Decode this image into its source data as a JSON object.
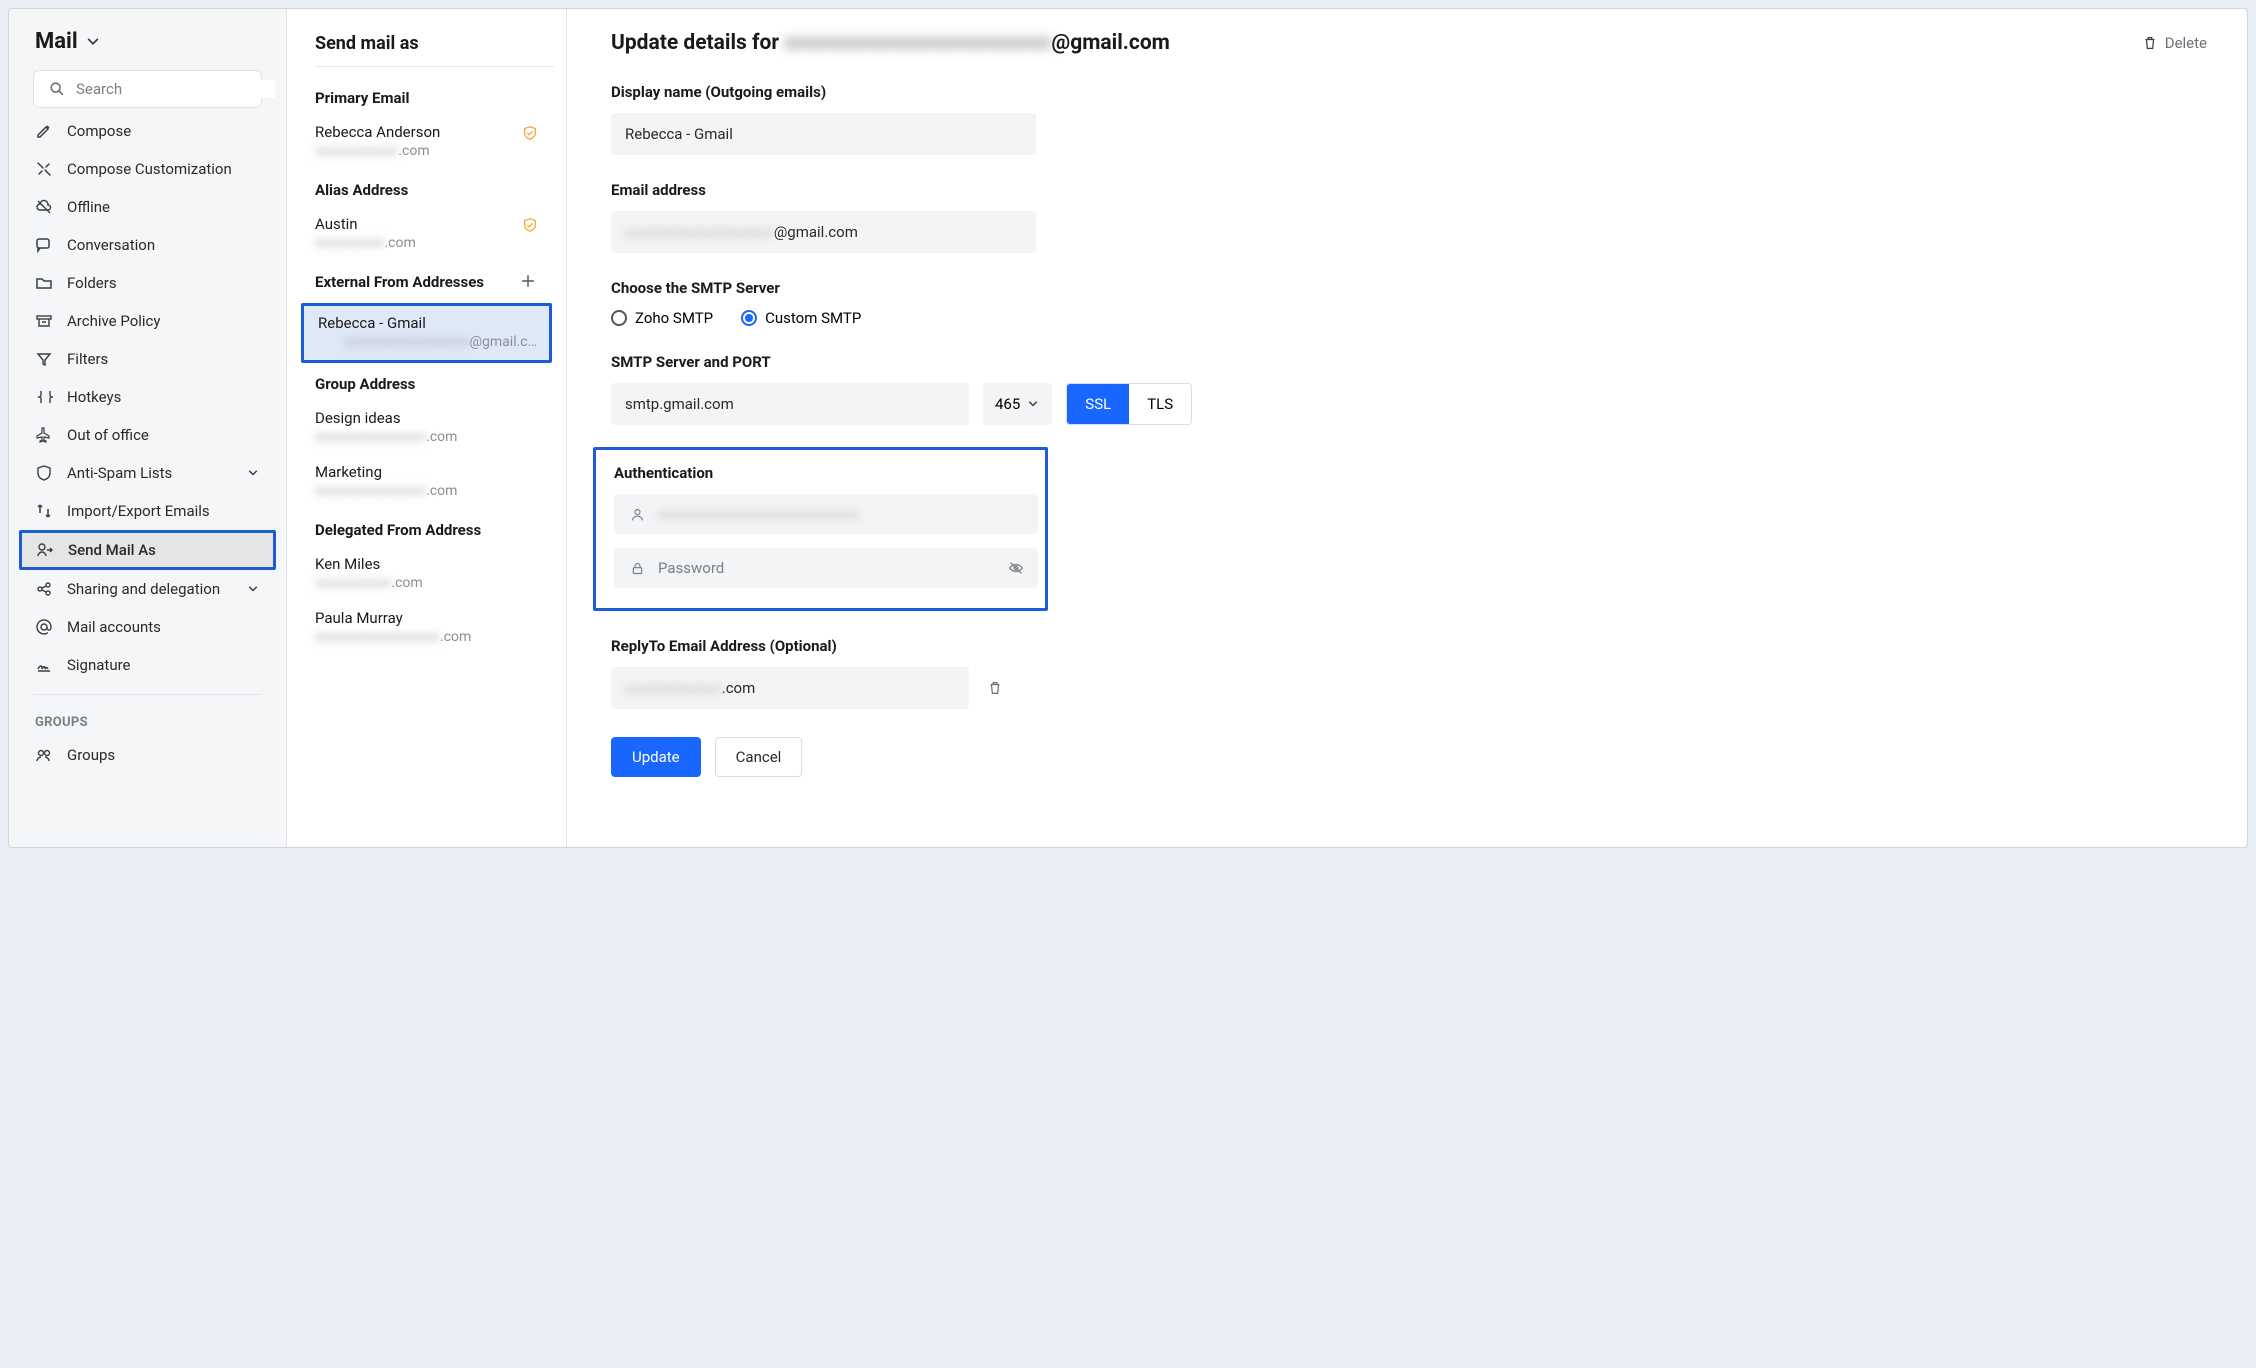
{
  "brand": {
    "title": "Mail"
  },
  "search": {
    "placeholder": "Search"
  },
  "nav": {
    "items": [
      {
        "label": "Compose",
        "icon": "compose-icon"
      },
      {
        "label": "Compose Customization",
        "icon": "customize-icon"
      },
      {
        "label": "Offline",
        "icon": "cloud-off-icon"
      },
      {
        "label": "Conversation",
        "icon": "chat-icon"
      },
      {
        "label": "Folders",
        "icon": "folder-icon"
      },
      {
        "label": "Archive Policy",
        "icon": "archive-icon"
      },
      {
        "label": "Filters",
        "icon": "filter-icon"
      },
      {
        "label": "Hotkeys",
        "icon": "keyboard-icon"
      },
      {
        "label": "Out of office",
        "icon": "plane-icon"
      },
      {
        "label": "Anti-Spam Lists",
        "icon": "shield-icon",
        "expandable": true
      },
      {
        "label": "Import/Export Emails",
        "icon": "transfer-icon"
      },
      {
        "label": "Send Mail As",
        "icon": "send-as-icon",
        "active": true
      },
      {
        "label": "Sharing and delegation",
        "icon": "share-icon",
        "expandable": true
      },
      {
        "label": "Mail accounts",
        "icon": "at-icon"
      },
      {
        "label": "Signature",
        "icon": "signature-icon"
      }
    ],
    "groups_label": "GROUPS",
    "groups_item": "Groups"
  },
  "mid": {
    "title": "Send mail as",
    "primary": {
      "heading": "Primary Email",
      "name": "Rebecca Anderson",
      "email_suffix": ".com"
    },
    "alias": {
      "heading": "Alias Address",
      "name": "Austin",
      "email_suffix": ".com"
    },
    "external": {
      "heading": "External From Addresses",
      "selected": {
        "name": "Rebecca - Gmail",
        "email_suffix": "@gmail.c…"
      }
    },
    "group": {
      "heading": "Group Address",
      "items": [
        {
          "name": "Design ideas",
          "email_suffix": ".com"
        },
        {
          "name": "Marketing",
          "email_suffix": ".com"
        }
      ]
    },
    "delegated": {
      "heading": "Delegated From Address",
      "items": [
        {
          "name": "Ken Miles",
          "email_suffix": ".com"
        },
        {
          "name": "Paula Murray",
          "email_suffix": ".com"
        }
      ]
    }
  },
  "detail": {
    "title_prefix": "Update details for ",
    "title_suffix": "@gmail.com",
    "delete_label": "Delete",
    "display_name": {
      "label": "Display name (Outgoing emails)",
      "value": "Rebecca - Gmail"
    },
    "email": {
      "label": "Email address",
      "value_suffix": "@gmail.com"
    },
    "smtp_choice": {
      "label": "Choose the SMTP Server",
      "options": [
        "Zoho SMTP",
        "Custom SMTP"
      ],
      "selected": "Custom SMTP"
    },
    "server": {
      "label": "SMTP Server and PORT",
      "host": "smtp.gmail.com",
      "port": "465",
      "ssl": "SSL",
      "tls": "TLS",
      "active_security": "SSL"
    },
    "auth": {
      "label": "Authentication",
      "password_placeholder": "Password"
    },
    "reply_to": {
      "label": "ReplyTo Email Address (Optional)",
      "value_suffix": ".com"
    },
    "actions": {
      "update": "Update",
      "cancel": "Cancel"
    }
  }
}
